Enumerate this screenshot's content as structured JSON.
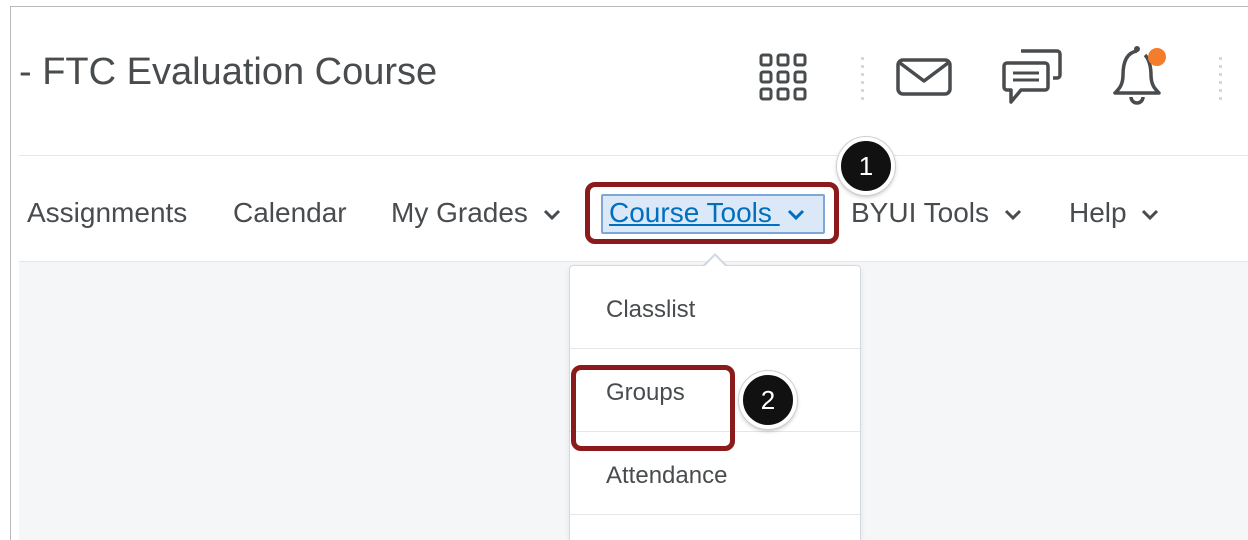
{
  "header": {
    "course_title": "- FTC Evaluation Course",
    "icons": [
      "apps-grid-icon",
      "mail-icon",
      "chat-icon",
      "bell-icon"
    ],
    "notification_color": "#f47d2c"
  },
  "nav": {
    "items": [
      {
        "label": "Assignments",
        "has_chevron": false
      },
      {
        "label": "Calendar",
        "has_chevron": false
      },
      {
        "label": "My Grades",
        "has_chevron": true
      },
      {
        "label": "Course Tools",
        "has_chevron": true,
        "active": true
      },
      {
        "label": "BYUI Tools",
        "has_chevron": true
      },
      {
        "label": "Help",
        "has_chevron": true
      }
    ]
  },
  "dropdown": {
    "items": [
      "Classlist",
      "Groups",
      "Attendance"
    ]
  },
  "callouts": {
    "step1": "1",
    "step2": "2"
  },
  "colors": {
    "text": "#494c4e",
    "link": "#006fbf",
    "highlight": "#8b1a1a"
  }
}
